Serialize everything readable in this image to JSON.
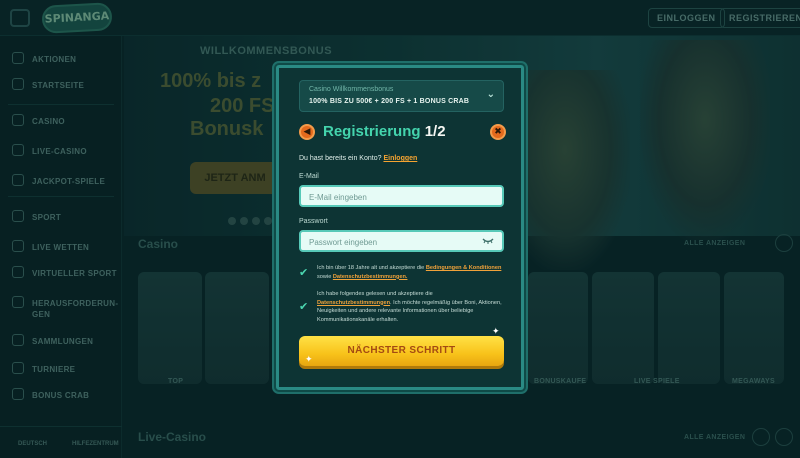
{
  "header": {
    "logo_text": "SPINANGA",
    "login_label": "EINLOGGEN",
    "register_label": "REGISTRIEREN"
  },
  "sidebar": {
    "items": [
      {
        "label": "AKTIONEN",
        "icon": "gift-icon"
      },
      {
        "label": "STARTSEITE",
        "icon": "home-icon"
      },
      {
        "label": "CASINO",
        "icon": "slot-icon"
      },
      {
        "label": "LIVE-CASINO",
        "icon": "cards-icon"
      },
      {
        "label": "JACKPOT-SPIELE",
        "icon": "jackpot-icon"
      },
      {
        "label": "SPORT",
        "icon": "ball-icon"
      },
      {
        "label": "LIVE WETTEN",
        "icon": "live-icon"
      },
      {
        "label": "VIRTUELLER SPORT",
        "icon": "virtual-icon"
      },
      {
        "label": "HERAUSFORDERUN-GEN",
        "icon": "challenge-icon"
      },
      {
        "label": "SAMMLUNGEN",
        "icon": "collection-icon"
      },
      {
        "label": "TURNIERE",
        "icon": "trophy-icon"
      },
      {
        "label": "BONUS CRAB",
        "icon": "crab-icon"
      }
    ],
    "language": "DEUTSCH",
    "help": "HILFEZENTRUM"
  },
  "hero": {
    "welcome": "WILLKOMMENSBONUS",
    "line1": "100% bis z",
    "line2": "200 FS",
    "line3": "Bonusk",
    "cta": "JETZT ANM"
  },
  "sections": {
    "casino_title": "Casino",
    "live_casino_title": "Live-Casino",
    "show_all": "ALLE ANZEIGEN",
    "tile_labels": [
      "TOP",
      "BONUSKAUFE",
      "LIVE SPIELE",
      "MEGAWAYS"
    ]
  },
  "modal": {
    "bonus_title": "Casino Willkommensbonus",
    "bonus_text": "100% BIS ZU 500€ + 200 FS + 1 BONUS CRAB",
    "title": "Registrierung",
    "step": "1/2",
    "have_account": "Du hast bereits ein Konto?",
    "login_link": "Einloggen",
    "email_label": "E-Mail",
    "email_placeholder": "E-Mail eingeben",
    "password_label": "Passwort",
    "password_placeholder": "Passwort eingeben",
    "consent1_text": "Ich bin über 18 Jahre alt und akzeptiere die",
    "consent1_link1": "Bedingungen & Konditionen",
    "consent1_mid": "sowie",
    "consent1_link2": "Datenschutzbestimmungen.",
    "consent2_text": "Ich habe folgendes gelesen und akzeptiere die",
    "consent2_link": "Datenschutzbestimmungen",
    "consent2_rest": ". Ich möchte regelmäßig über Boni, Aktionen, Neuigkeiten und andere relevante Informationen über beliebige Kommunikationskanäle erhalten.",
    "next_label": "NÄCHSTER SCHRITT"
  },
  "colors": {
    "accent_teal": "#44d4ad",
    "accent_orange": "#f5a431",
    "button_yellow": "#f8c21a",
    "background": "#0a2a2c"
  }
}
